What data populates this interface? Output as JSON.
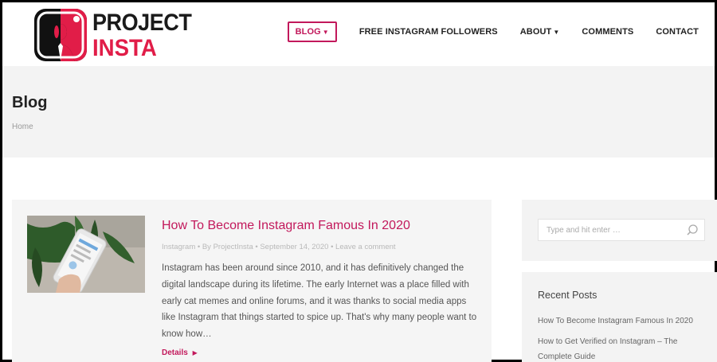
{
  "header": {
    "logo": {
      "line1": "PROJECT",
      "line2": "INSTA"
    },
    "nav": [
      {
        "label": "BLOG",
        "has_dropdown": true,
        "active": true
      },
      {
        "label": "FREE INSTAGRAM FOLLOWERS",
        "has_dropdown": false
      },
      {
        "label": "ABOUT",
        "has_dropdown": true
      },
      {
        "label": "COMMENTS",
        "has_dropdown": false
      },
      {
        "label": "CONTACT",
        "has_dropdown": false
      }
    ],
    "dropdown_icon": "chevron-down-icon"
  },
  "title_bar": {
    "title": "Blog",
    "breadcrumb": "Home"
  },
  "post": {
    "title": "How To Become Instagram Famous In 2020",
    "meta": "Instagram • By ProjectInsta • September 14, 2020 • Leave a comment",
    "excerpt": "Instagram has been around since 2010, and it has definitively changed the digital landscape during its lifetime. The early Internet was a place filled with early cat memes and online forums, and it was thanks to social media apps like Instagram that things started to spice up. That's why many people want to know how…",
    "details_label": "Details"
  },
  "sidebar": {
    "search_placeholder": "Type and hit enter …",
    "recent_title": "Recent Posts",
    "recent_posts": [
      "How To Become Instagram Famous In 2020",
      "How to Get Verified on Instagram – The Complete Guide"
    ]
  },
  "colors": {
    "accent": "#c2185b",
    "logo_pink": "#e11d48",
    "text_dark": "#222222"
  }
}
